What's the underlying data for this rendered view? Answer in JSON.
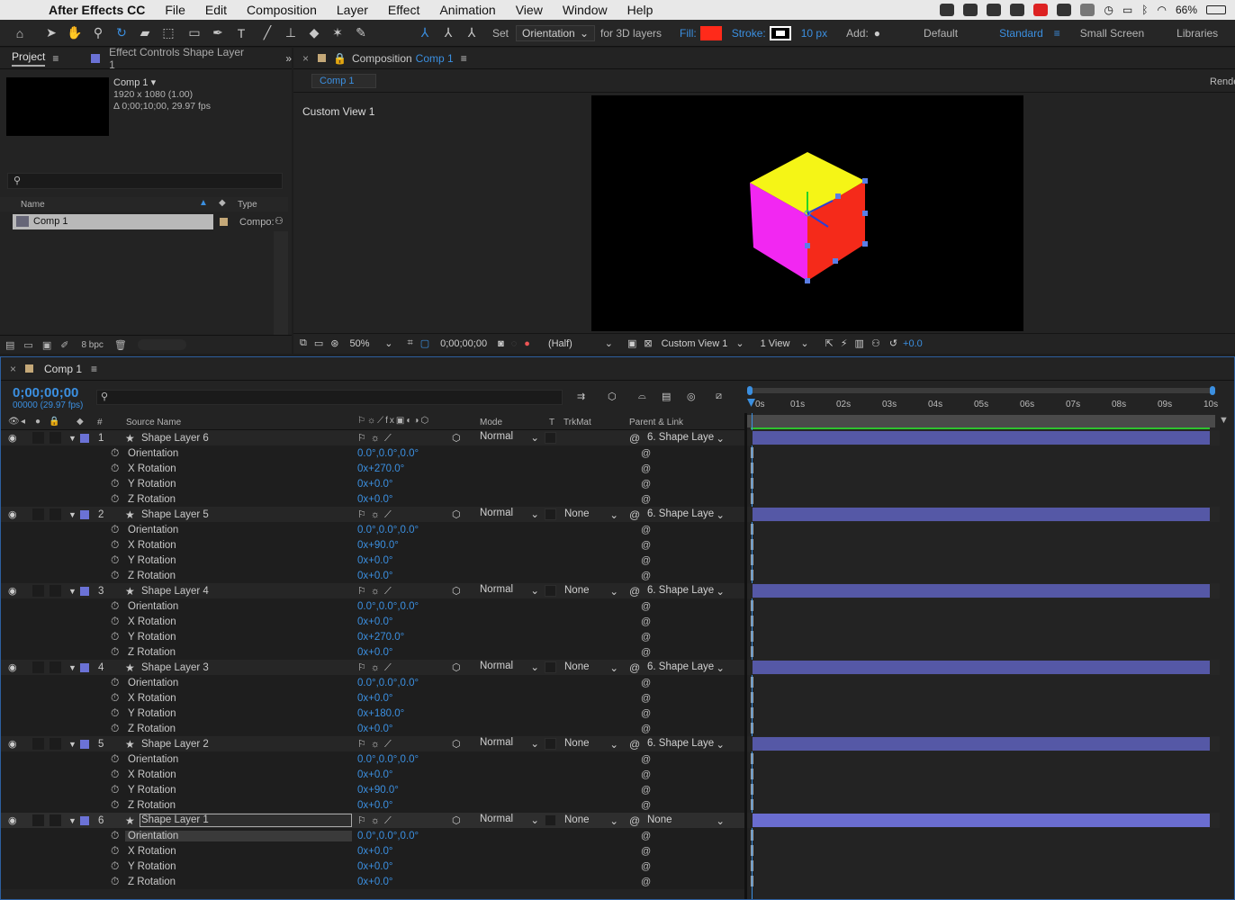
{
  "menubar": {
    "app": "After Effects CC",
    "items": [
      "File",
      "Edit",
      "Composition",
      "Layer",
      "Effect",
      "Animation",
      "View",
      "Window",
      "Help"
    ],
    "battery": "66%"
  },
  "toolbar": {
    "set_label": "Set",
    "orientation_value": "Orientation",
    "for3d_label": "for 3D layers",
    "fill_label": "Fill:",
    "fill_color": "#ff2a1a",
    "stroke_label": "Stroke:",
    "stroke_width": "10 px",
    "add_label": "Add:",
    "workspaces": [
      "Default",
      "Standard",
      "Small Screen",
      "Libraries"
    ],
    "active_workspace": "Standard"
  },
  "project_panel": {
    "tab_label": "Project",
    "effect_controls_tab": "Effect Controls Shape Layer 1",
    "comp_name": "Comp 1 ▾",
    "comp_res": "1920 x 1080 (1.00)",
    "comp_duration": "Δ 0;00;10;00, 29.97 fps",
    "col_name": "Name",
    "col_type": "Type",
    "item_name": "Comp 1",
    "item_type": "Compo:",
    "bpc": "8 bpc"
  },
  "composition_panel": {
    "header_label": "Composition",
    "header_comp": "Comp 1",
    "tab_label": "Comp 1",
    "view_label": "Custom View 1",
    "render_label": "Rende",
    "zoom": "50%",
    "timecode": "0;00;00;00",
    "resolution": "(Half)",
    "view_dd": "Custom View 1",
    "views_count": "1 View",
    "exposure": "+0.0"
  },
  "cube_colors": {
    "top": "#f5f516",
    "left": "#f227f2",
    "right": "#f52a1a"
  },
  "timeline": {
    "tab_label": "Comp 1",
    "timecode": "0;00;00;00",
    "frame_info": "00000 (29.97 fps)",
    "col_source": "Source Name",
    "col_mode": "Mode",
    "col_t": "T",
    "col_trkmat": "TrkMat",
    "col_parent": "Parent & Link",
    "ruler": [
      "0s",
      "01s",
      "02s",
      "03s",
      "04s",
      "05s",
      "06s",
      "07s",
      "08s",
      "09s",
      "10s"
    ],
    "layers": [
      {
        "num": "1",
        "name": "Shape Layer 6",
        "mode": "Normal",
        "trkmat": "",
        "parent": "6. Shape Laye",
        "props": [
          {
            "name": "Orientation",
            "value": "0.0°,0.0°,0.0°"
          },
          {
            "name": "X Rotation",
            "value": "0x+270.0°"
          },
          {
            "name": "Y Rotation",
            "value": "0x+0.0°"
          },
          {
            "name": "Z Rotation",
            "value": "0x+0.0°"
          }
        ]
      },
      {
        "num": "2",
        "name": "Shape Layer 5",
        "mode": "Normal",
        "trkmat": "None",
        "parent": "6. Shape Laye",
        "props": [
          {
            "name": "Orientation",
            "value": "0.0°,0.0°,0.0°"
          },
          {
            "name": "X Rotation",
            "value": "0x+90.0°"
          },
          {
            "name": "Y Rotation",
            "value": "0x+0.0°"
          },
          {
            "name": "Z Rotation",
            "value": "0x+0.0°"
          }
        ]
      },
      {
        "num": "3",
        "name": "Shape Layer 4",
        "mode": "Normal",
        "trkmat": "None",
        "parent": "6. Shape Laye",
        "props": [
          {
            "name": "Orientation",
            "value": "0.0°,0.0°,0.0°"
          },
          {
            "name": "X Rotation",
            "value": "0x+0.0°"
          },
          {
            "name": "Y Rotation",
            "value": "0x+270.0°"
          },
          {
            "name": "Z Rotation",
            "value": "0x+0.0°"
          }
        ]
      },
      {
        "num": "4",
        "name": "Shape Layer 3",
        "mode": "Normal",
        "trkmat": "None",
        "parent": "6. Shape Laye",
        "props": [
          {
            "name": "Orientation",
            "value": "0.0°,0.0°,0.0°"
          },
          {
            "name": "X Rotation",
            "value": "0x+0.0°"
          },
          {
            "name": "Y Rotation",
            "value": "0x+180.0°"
          },
          {
            "name": "Z Rotation",
            "value": "0x+0.0°"
          }
        ]
      },
      {
        "num": "5",
        "name": "Shape Layer 2",
        "mode": "Normal",
        "trkmat": "None",
        "parent": "6. Shape Laye",
        "props": [
          {
            "name": "Orientation",
            "value": "0.0°,0.0°,0.0°"
          },
          {
            "name": "X Rotation",
            "value": "0x+0.0°"
          },
          {
            "name": "Y Rotation",
            "value": "0x+90.0°"
          },
          {
            "name": "Z Rotation",
            "value": "0x+0.0°"
          }
        ]
      },
      {
        "num": "6",
        "name": "Shape Layer 1",
        "mode": "Normal",
        "trkmat": "None",
        "parent": "None",
        "props": [
          {
            "name": "Orientation",
            "value": "0.0°,0.0°,0.0°"
          },
          {
            "name": "X Rotation",
            "value": "0x+0.0°"
          },
          {
            "name": "Y Rotation",
            "value": "0x+0.0°"
          },
          {
            "name": "Z Rotation",
            "value": "0x+0.0°"
          }
        ]
      }
    ]
  }
}
